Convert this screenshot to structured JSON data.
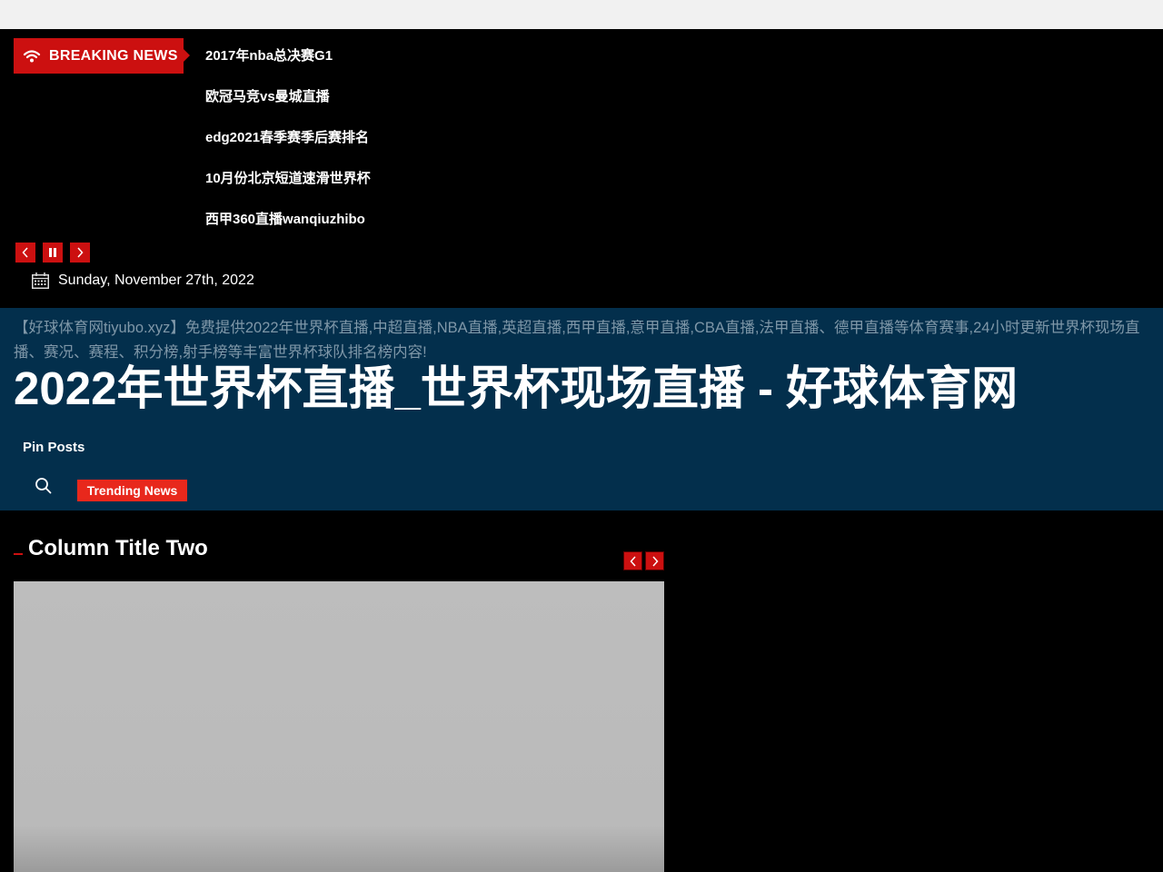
{
  "breaking": {
    "label": "BREAKING NEWS",
    "items": [
      "2017年nba总决赛G1",
      "欧冠马竞vs曼城直播",
      "edg2021春季赛季后赛排名",
      "10月份北京短道速滑世界杯",
      "西甲360直播wanqiuzhibo"
    ]
  },
  "date": "Sunday, November 27th, 2022",
  "site": {
    "description": "【好球体育网tiyubo.xyz】免费提供2022年世界杯直播,中超直播,NBA直播,英超直播,西甲直播,意甲直播,CBA直播,法甲直播、德甲直播等体育赛事,24小时更新世界杯现场直播、赛况、赛程、积分榜,射手榜等丰富世界杯球队排名榜内容!",
    "title": "2022年世界杯直播_世界杯现场直播 - 好球体育网"
  },
  "nav": {
    "pin_posts": "Pin Posts",
    "trending": "Trending News"
  },
  "column": {
    "title": "Column Title Two"
  },
  "colors": {
    "accent_red": "#cc1010",
    "header_bg": "#032f4c",
    "trending_bg": "#e8281c"
  },
  "icons": [
    "wifi-icon",
    "prev-icon",
    "pause-icon",
    "next-icon",
    "calendar-icon",
    "search-icon"
  ]
}
